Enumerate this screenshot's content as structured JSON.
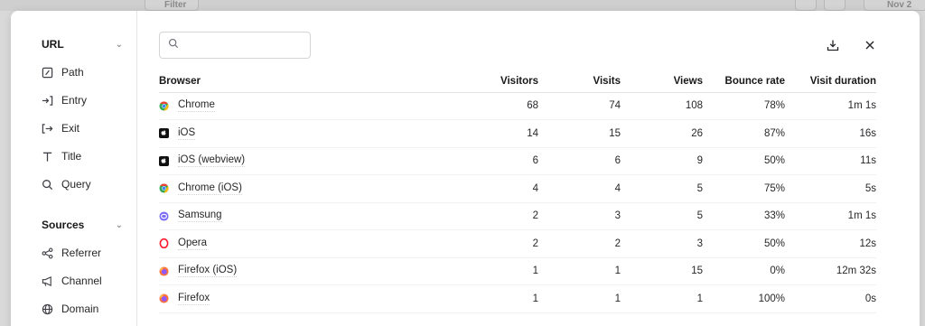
{
  "background": {
    "filter_label": "Filter",
    "date_label": "Nov 2"
  },
  "sidebar": {
    "sections": [
      {
        "title": "URL",
        "items": [
          {
            "label": "Path",
            "icon": "path-icon"
          },
          {
            "label": "Entry",
            "icon": "entry-icon"
          },
          {
            "label": "Exit",
            "icon": "exit-icon"
          },
          {
            "label": "Title",
            "icon": "title-icon"
          },
          {
            "label": "Query",
            "icon": "search-icon"
          }
        ]
      },
      {
        "title": "Sources",
        "items": [
          {
            "label": "Referrer",
            "icon": "share-icon"
          },
          {
            "label": "Channel",
            "icon": "megaphone-icon"
          },
          {
            "label": "Domain",
            "icon": "globe-icon"
          }
        ]
      }
    ]
  },
  "search": {
    "value": "",
    "placeholder": ""
  },
  "table": {
    "headers": [
      "Browser",
      "Visitors",
      "Visits",
      "Views",
      "Bounce rate",
      "Visit duration"
    ],
    "rows": [
      {
        "browser": "Chrome",
        "icon": "chrome-icon",
        "visitors": "68",
        "visits": "74",
        "views": "108",
        "bounce": "78%",
        "duration": "1m 1s"
      },
      {
        "browser": "iOS",
        "icon": "apple-icon",
        "visitors": "14",
        "visits": "15",
        "views": "26",
        "bounce": "87%",
        "duration": "16s"
      },
      {
        "browser": "iOS (webview)",
        "icon": "apple-icon",
        "visitors": "6",
        "visits": "6",
        "views": "9",
        "bounce": "50%",
        "duration": "11s"
      },
      {
        "browser": "Chrome (iOS)",
        "icon": "chrome-icon",
        "visitors": "4",
        "visits": "4",
        "views": "5",
        "bounce": "75%",
        "duration": "5s"
      },
      {
        "browser": "Samsung",
        "icon": "samsung-icon",
        "visitors": "2",
        "visits": "3",
        "views": "5",
        "bounce": "33%",
        "duration": "1m 1s"
      },
      {
        "browser": "Opera",
        "icon": "opera-icon",
        "visitors": "2",
        "visits": "2",
        "views": "3",
        "bounce": "50%",
        "duration": "12s"
      },
      {
        "browser": "Firefox (iOS)",
        "icon": "firefox-icon",
        "visitors": "1",
        "visits": "1",
        "views": "15",
        "bounce": "0%",
        "duration": "12m 32s"
      },
      {
        "browser": "Firefox",
        "icon": "firefox-icon",
        "visitors": "1",
        "visits": "1",
        "views": "1",
        "bounce": "100%",
        "duration": "0s"
      }
    ]
  },
  "colors": {
    "chrome_red": "#ea4335",
    "chrome_green": "#34a853",
    "chrome_yellow": "#fbbc05",
    "chrome_blue": "#4285f4",
    "samsung": "#7b6cf6",
    "opera": "#ff1b2d",
    "firefox_orange": "#ff7139",
    "firefox_purple": "#9059ff"
  }
}
